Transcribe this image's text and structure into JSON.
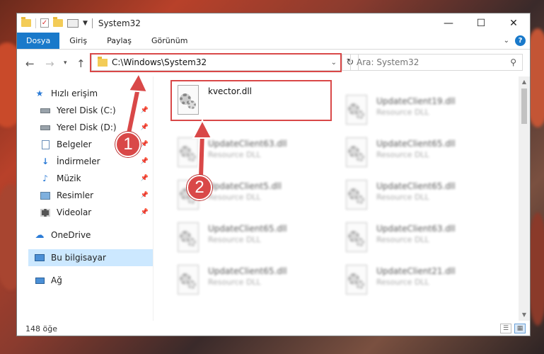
{
  "window": {
    "title": "System32",
    "controls": {
      "minimize": "—",
      "maximize": "☐",
      "close": "✕"
    }
  },
  "ribbon": {
    "tabs": [
      "Dosya",
      "Giriş",
      "Paylaş",
      "Görünüm"
    ],
    "help": "?"
  },
  "nav": {
    "address": "C:\\Windows\\System32",
    "search_placeholder": "Ara: System32"
  },
  "sidebar": {
    "quick_access": "Hızlı erişim",
    "items": [
      {
        "label": "Yerel Disk (C:)",
        "icon": "drive-icon",
        "pinned": true
      },
      {
        "label": "Yerel Disk (D:)",
        "icon": "drive-icon",
        "pinned": true
      },
      {
        "label": "Belgeler",
        "icon": "documents-icon",
        "pinned": true
      },
      {
        "label": "İndirmeler",
        "icon": "download-icon",
        "pinned": true
      },
      {
        "label": "Müzik",
        "icon": "music-icon",
        "pinned": true
      },
      {
        "label": "Resimler",
        "icon": "pictures-icon",
        "pinned": true
      },
      {
        "label": "Videolar",
        "icon": "videos-icon",
        "pinned": true
      }
    ],
    "onedrive": "OneDrive",
    "this_pc": "Bu bilgisayar",
    "network": "Ağ"
  },
  "files": [
    {
      "name": "kvector.dll",
      "type": "",
      "col": 0,
      "row": 0,
      "highlighted": true
    },
    {
      "name": "UpdateClient19.dll",
      "type": "Resource DLL",
      "col": 1,
      "row": 0
    },
    {
      "name": "UpdateClient63.dll",
      "type": "Resource DLL",
      "col": 0,
      "row": 1
    },
    {
      "name": "UpdateClient65.dll",
      "type": "Resource DLL",
      "col": 1,
      "row": 1
    },
    {
      "name": "UpdateClient5.dll",
      "type": "Resource DLL",
      "col": 0,
      "row": 2
    },
    {
      "name": "UpdateClient65.dll",
      "type": "Resource DLL",
      "col": 1,
      "row": 2
    },
    {
      "name": "UpdateClient65.dll",
      "type": "Resource DLL",
      "col": 0,
      "row": 3
    },
    {
      "name": "UpdateClient63.dll",
      "type": "Resource DLL",
      "col": 1,
      "row": 3
    },
    {
      "name": "UpdateClient65.dll",
      "type": "Resource DLL",
      "col": 0,
      "row": 4
    },
    {
      "name": "UpdateClient21.dll",
      "type": "Resource DLL",
      "col": 1,
      "row": 4
    }
  ],
  "status": {
    "count": "148 öğe"
  },
  "annotations": {
    "step1": "1",
    "step2": "2",
    "color": "#d94848"
  }
}
